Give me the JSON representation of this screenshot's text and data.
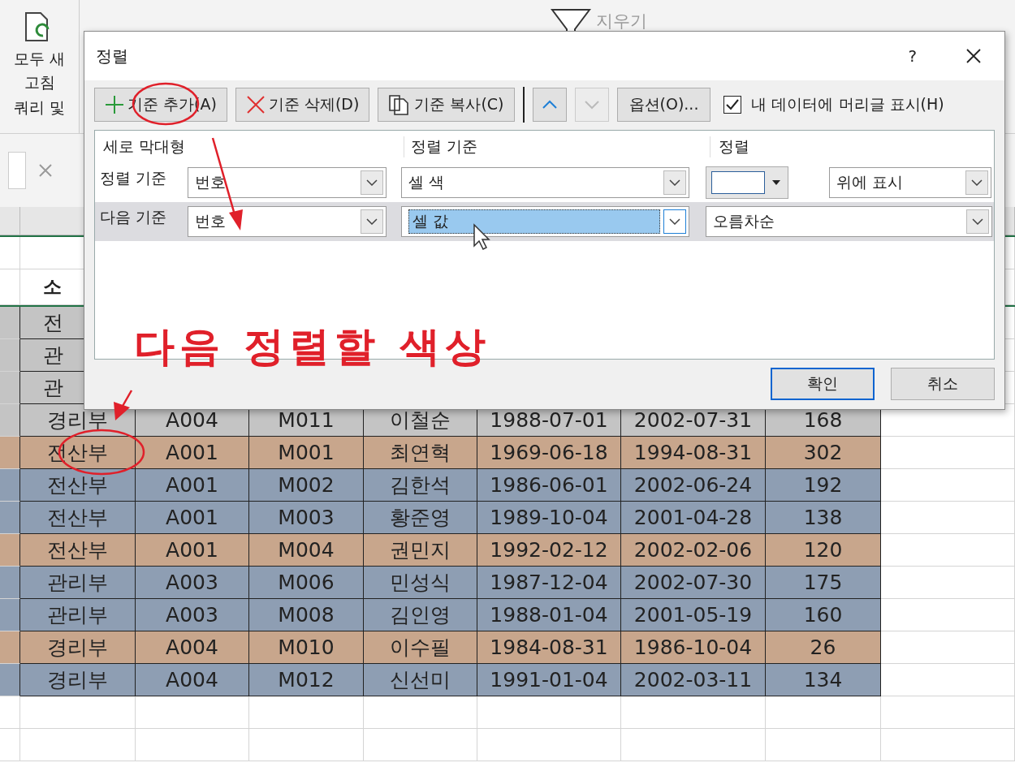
{
  "ribbon": {
    "refresh_label": [
      "모두 새",
      "고침"
    ],
    "group_label": "쿼리 및",
    "clear_label": "지우기"
  },
  "sheet": {
    "header_cell": "소",
    "rows": [
      {
        "color": "#c4c4c4",
        "cells": [
          "전"
        ]
      },
      {
        "color": "#c4c4c4",
        "cells": [
          "관"
        ]
      },
      {
        "color": "#c4c4c4",
        "cells": [
          "관"
        ]
      },
      {
        "color": "#c4c4c4",
        "cells": [
          "경리부",
          "A004",
          "M011",
          "이철순",
          "1988-07-01",
          "2002-07-31",
          "168"
        ]
      },
      {
        "color": "#c8a68c",
        "cells": [
          "전산부",
          "A001",
          "M001",
          "최연혁",
          "1969-06-18",
          "1994-08-31",
          "302"
        ]
      },
      {
        "color": "#8e9eb3",
        "cells": [
          "전산부",
          "A001",
          "M002",
          "김한석",
          "1986-06-01",
          "2002-06-24",
          "192"
        ]
      },
      {
        "color": "#8e9eb3",
        "cells": [
          "전산부",
          "A001",
          "M003",
          "황준영",
          "1989-10-04",
          "2001-04-28",
          "138"
        ]
      },
      {
        "color": "#c8a68c",
        "cells": [
          "전산부",
          "A001",
          "M004",
          "권민지",
          "1992-02-12",
          "2002-02-06",
          "120"
        ]
      },
      {
        "color": "#8e9eb3",
        "cells": [
          "관리부",
          "A003",
          "M006",
          "민성식",
          "1987-12-04",
          "2002-07-30",
          "175"
        ]
      },
      {
        "color": "#8e9eb3",
        "cells": [
          "관리부",
          "A003",
          "M008",
          "김인영",
          "1988-01-04",
          "2001-05-19",
          "160"
        ]
      },
      {
        "color": "#c8a68c",
        "cells": [
          "경리부",
          "A004",
          "M010",
          "이수필",
          "1984-08-31",
          "1986-10-04",
          "26"
        ]
      },
      {
        "color": "#8e9eb3",
        "cells": [
          "경리부",
          "A004",
          "M012",
          "신선미",
          "1991-01-04",
          "2002-03-11",
          "134"
        ]
      }
    ]
  },
  "dialog": {
    "title": "정렬",
    "help": "?",
    "toolbar": [
      {
        "kind": "add",
        "label": "기준 추가(A)"
      },
      {
        "kind": "delete",
        "label": "기준 삭제(D)"
      },
      {
        "kind": "copy",
        "label": "기준 복사(C)"
      }
    ],
    "move_up": {
      "disabled": false
    },
    "move_down": {
      "disabled": true
    },
    "options": "옵션(O)...",
    "header_checkbox": {
      "label": "내 데이터에 머리글 표시(H)",
      "checked": true
    },
    "columns": [
      "세로 막대형",
      "정렬 기준",
      "정렬"
    ],
    "levels": [
      {
        "label": "정렬 기준",
        "column": "번호",
        "sort_on": "셀 색",
        "kind": "color_order",
        "order": "위에 표시",
        "selected": false
      },
      {
        "label": "다음 기준",
        "column": "번호",
        "sort_on": "셀 값",
        "kind": "value_order",
        "order": "오름차순",
        "selected": true
      }
    ],
    "ok": "확인",
    "cancel": "취소"
  },
  "annotation": {
    "note": "다음 정렬할 색상"
  }
}
